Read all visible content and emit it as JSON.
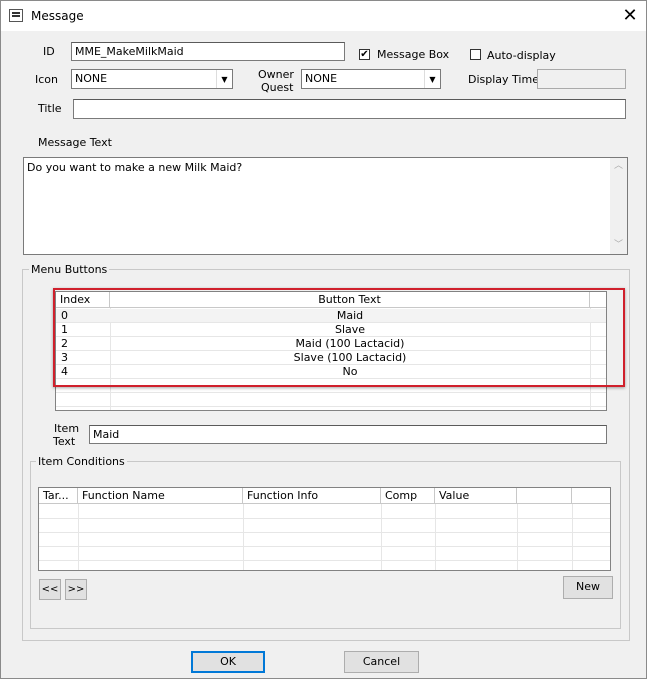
{
  "window": {
    "title": "Message",
    "close_glyph": "✕"
  },
  "form": {
    "id_label": "ID",
    "id_value": "MME_MakeMilkMaid",
    "message_box_label": "Message Box",
    "message_box_checked": true,
    "auto_display_label": "Auto-display",
    "auto_display_checked": false,
    "icon_label": "Icon",
    "icon_value": "NONE",
    "owner_quest_label_1": "Owner",
    "owner_quest_label_2": "Quest",
    "owner_quest_value": "NONE",
    "display_time_label": "Display Time",
    "display_time_value": "",
    "title_label": "Title",
    "title_value": "",
    "message_text_label": "Message Text",
    "message_text_value": "Do you want to make a new Milk Maid?"
  },
  "menu_buttons": {
    "group_label": "Menu Buttons",
    "columns": [
      "Index",
      "Button Text"
    ],
    "rows": [
      {
        "index": "0",
        "text": "Maid"
      },
      {
        "index": "1",
        "text": "Slave"
      },
      {
        "index": "2",
        "text": "Maid (100 Lactacid)"
      },
      {
        "index": "3",
        "text": "Slave (100 Lactacid)"
      },
      {
        "index": "4",
        "text": "No"
      }
    ],
    "item_text_label_1": "Item",
    "item_text_label_2": "Text",
    "item_text_value": "Maid",
    "highlight_color": "#d0202c"
  },
  "item_conditions": {
    "group_label": "Item Conditions",
    "columns": [
      "Tar...",
      "Function Name",
      "Function Info",
      "Comp",
      "Value",
      "",
      ""
    ],
    "prev_label": "<<",
    "next_label": ">>",
    "new_label": "New"
  },
  "footer": {
    "ok_label": "OK",
    "cancel_label": "Cancel"
  }
}
